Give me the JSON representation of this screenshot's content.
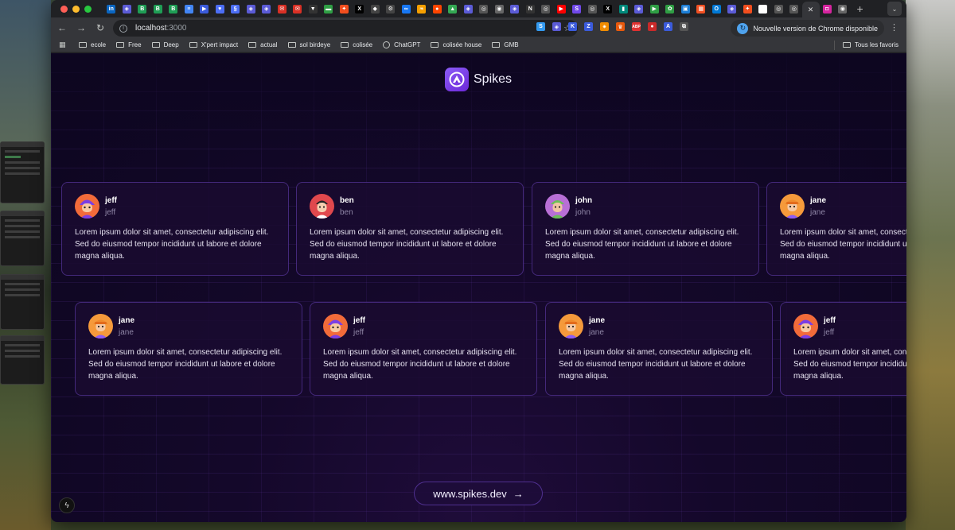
{
  "browser": {
    "traffic_lights": [
      "#ff5f57",
      "#febc2e",
      "#28c840"
    ],
    "tab_favicons": [
      {
        "name": "linkedin-tab",
        "glyph": "in",
        "color": "#0a66c2"
      },
      {
        "name": "figma-tab",
        "glyph": "◈",
        "color": "#5b5bd6"
      },
      {
        "name": "b-tab-1",
        "glyph": "B",
        "color": "#1f9d55"
      },
      {
        "name": "b-tab-2",
        "glyph": "B",
        "color": "#1f9d55"
      },
      {
        "name": "b-tab-3",
        "glyph": "B",
        "color": "#1f9d55"
      },
      {
        "name": "docs-tab",
        "glyph": "≡",
        "color": "#4285f4"
      },
      {
        "name": "flag-tab",
        "glyph": "▶",
        "color": "#3b5bdb"
      },
      {
        "name": "shield-tab",
        "glyph": "♥",
        "color": "#4c6ef5"
      },
      {
        "name": "link-tab",
        "glyph": "§",
        "color": "#4c6ef5"
      },
      {
        "name": "grid-tab-1",
        "glyph": "◈",
        "color": "#5b5bd6"
      },
      {
        "name": "grid-tab-2",
        "glyph": "◈",
        "color": "#5b5bd6"
      },
      {
        "name": "gmail-tab-1",
        "glyph": "✉",
        "color": "#d93025"
      },
      {
        "name": "gmail-tab-2",
        "glyph": "✉",
        "color": "#d93025"
      },
      {
        "name": "v-tab",
        "glyph": "▼",
        "color": "#333333"
      },
      {
        "name": "green-tab",
        "glyph": "▬",
        "color": "#2f9e44"
      },
      {
        "name": "figma-tab-2",
        "glyph": "✦",
        "color": "#f24e1e"
      },
      {
        "name": "x-tab-1",
        "glyph": "X",
        "color": "#000000"
      },
      {
        "name": "notion-like-tab",
        "glyph": "◆",
        "color": "#444444"
      },
      {
        "name": "openai-tab",
        "glyph": "⚙",
        "color": "#444444"
      },
      {
        "name": "meta-tab",
        "glyph": "∞",
        "color": "#1877f2"
      },
      {
        "name": "leaf-tab",
        "glyph": "❧",
        "color": "#f59f00"
      },
      {
        "name": "reddit-tab",
        "glyph": "●",
        "color": "#ff4500"
      },
      {
        "name": "drive-tab",
        "glyph": "▲",
        "color": "#34a853"
      },
      {
        "name": "grid-tab-3",
        "glyph": "◈",
        "color": "#5b5bd6"
      },
      {
        "name": "globe-tab-1",
        "glyph": "◎",
        "color": "#555555"
      },
      {
        "name": "chrome-tab-1",
        "glyph": "◉",
        "color": "#666666"
      },
      {
        "name": "grid-tab-4",
        "glyph": "◈",
        "color": "#5b5bd6"
      },
      {
        "name": "notion-tab",
        "glyph": "N",
        "color": "#333333"
      },
      {
        "name": "globe-tab-2",
        "glyph": "◎",
        "color": "#555555"
      },
      {
        "name": "youtube-tab",
        "glyph": "▶",
        "color": "#ff0000"
      },
      {
        "name": "s-tab",
        "glyph": "S",
        "color": "#7048e8"
      },
      {
        "name": "globe-tab-3",
        "glyph": "◎",
        "color": "#555555"
      },
      {
        "name": "x-tab-2",
        "glyph": "X",
        "color": "#000000"
      },
      {
        "name": "meet-tab",
        "glyph": "▮",
        "color": "#00897b"
      },
      {
        "name": "grid-tab-5",
        "glyph": "◈",
        "color": "#5b5bd6"
      },
      {
        "name": "green-2-tab",
        "glyph": "▶",
        "color": "#2f9e44"
      },
      {
        "name": "s-green-tab",
        "glyph": "✿",
        "color": "#2f9e44"
      },
      {
        "name": "box-tab",
        "glyph": "▣",
        "color": "#1c7ed6"
      },
      {
        "name": "ms-tab",
        "glyph": "▦",
        "color": "#f25022"
      },
      {
        "name": "outlook-tab",
        "glyph": "O",
        "color": "#0078d4"
      },
      {
        "name": "grid-tab-6",
        "glyph": "◈",
        "color": "#5b5bd6"
      },
      {
        "name": "figma-tab-3",
        "glyph": "✦",
        "color": "#f24e1e"
      },
      {
        "name": "google-tab",
        "glyph": "G",
        "color": "#ffffff"
      },
      {
        "name": "globe-tab-4",
        "glyph": "◎",
        "color": "#555555"
      },
      {
        "name": "globe-tab-5",
        "glyph": "◎",
        "color": "#555555"
      }
    ],
    "active_tab_close": "✕",
    "after_tabs": [
      {
        "name": "instagram-tab",
        "glyph": "◘",
        "color": "#d6249f"
      },
      {
        "name": "chrome-tab-2",
        "glyph": "◉",
        "color": "#666666"
      }
    ],
    "new_tab": "+",
    "tab_menu": "⌄",
    "url_host": "localhost",
    "url_port": ":3000",
    "update_text": "Nouvelle version de Chrome disponible",
    "bookmarks": [
      "ecole",
      "Free",
      "Deep",
      "X'pert impact",
      "actual",
      "sol birdeye",
      "colisée",
      "ChatGPT",
      "colisée house",
      "GMB"
    ],
    "bookmarks_right": "Tous les favoris",
    "extensions": [
      {
        "glyph": "S",
        "color": "#339af0"
      },
      {
        "glyph": "◈",
        "color": "#5b5bd6"
      },
      {
        "glyph": "K",
        "color": "#3b5bdb"
      },
      {
        "glyph": "Z",
        "color": "#3b5bdb"
      },
      {
        "glyph": "✷",
        "color": "#f08c00"
      },
      {
        "glyph": "♛",
        "color": "#e8590c"
      },
      {
        "glyph": "ABP",
        "color": "#e03131"
      },
      {
        "glyph": "●",
        "color": "#c92a2a"
      },
      {
        "glyph": "A",
        "color": "#3b5bdb"
      },
      {
        "glyph": "⧉",
        "color": "#555555"
      }
    ]
  },
  "page": {
    "brand_name": "Spikes",
    "cta_text": "www.spikes.dev",
    "cta_arrow": "→",
    "nx_badge": "ϟ",
    "quote": "Lorem ipsum dolor sit amet, consectetur adipiscing elit. Sed do eiusmod tempor incididunt ut labore et dolore magna aliqua.",
    "row1": [
      {
        "name": "jeff",
        "handle": "jeff",
        "avatar": "jeff"
      },
      {
        "name": "ben",
        "handle": "ben",
        "avatar": "ben"
      },
      {
        "name": "john",
        "handle": "john",
        "avatar": "john"
      },
      {
        "name": "jane",
        "handle": "jane",
        "avatar": "jane"
      }
    ],
    "row2": [
      {
        "name": "jane",
        "handle": "jane",
        "avatar": "jane"
      },
      {
        "name": "jeff",
        "handle": "jeff",
        "avatar": "jeff"
      },
      {
        "name": "jane",
        "handle": "jane",
        "avatar": "jane"
      },
      {
        "name": "jeff",
        "handle": "jeff",
        "avatar": "jeff"
      }
    ],
    "colors": {
      "accent": "#8b5cf6",
      "background": "#0d0620",
      "card_border": "#6d45b8"
    }
  }
}
